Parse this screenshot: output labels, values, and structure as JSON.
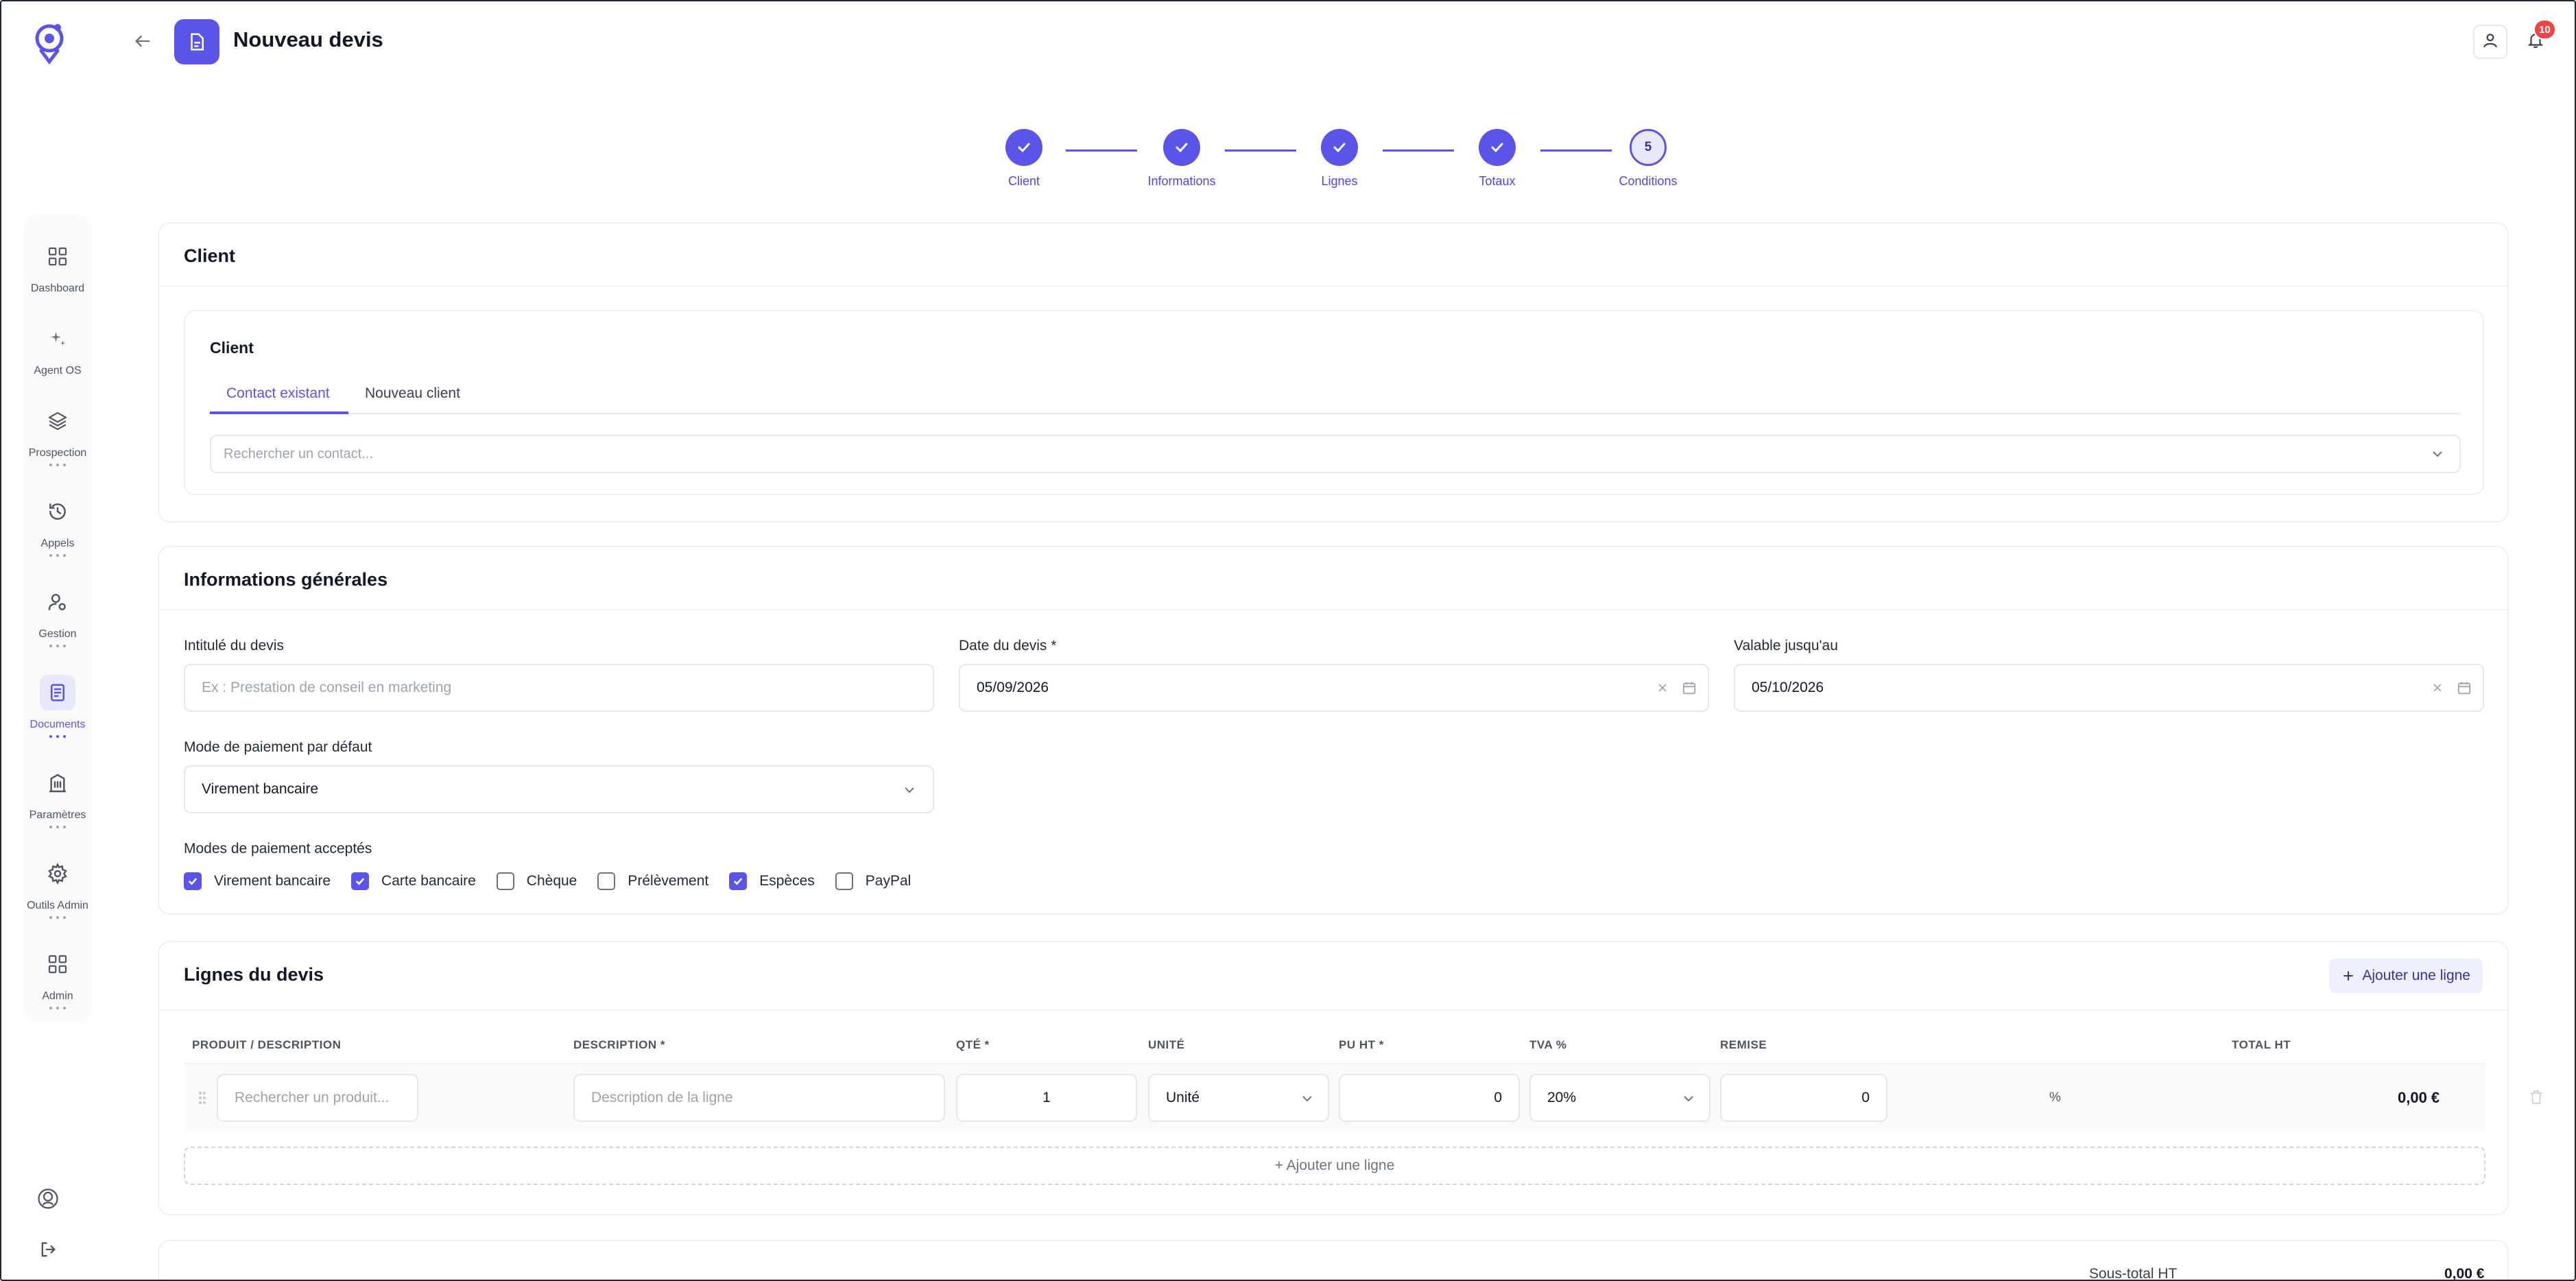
{
  "header": {
    "title": "Nouveau devis",
    "notification_count": "10"
  },
  "sidebar": {
    "items": [
      {
        "label": "Dashboard",
        "icon": "grid-icon",
        "active": false
      },
      {
        "label": "Agent OS",
        "icon": "sparkles-icon",
        "active": false
      },
      {
        "label": "Prospection",
        "icon": "layers-icon",
        "active": false
      },
      {
        "label": "Appels",
        "icon": "history-icon",
        "active": false
      },
      {
        "label": "Gestion",
        "icon": "user-settings-icon",
        "active": false
      },
      {
        "label": "Documents",
        "icon": "document-icon",
        "active": true
      },
      {
        "label": "Paramètres",
        "icon": "building-icon",
        "active": false
      },
      {
        "label": "Outils Admin",
        "icon": "gear-icon",
        "active": false
      },
      {
        "label": "Admin",
        "icon": "grid-icon",
        "active": false
      }
    ]
  },
  "stepper": {
    "steps": [
      {
        "label": "Client",
        "done": true
      },
      {
        "label": "Informations",
        "done": true
      },
      {
        "label": "Lignes",
        "done": true
      },
      {
        "label": "Totaux",
        "done": true
      },
      {
        "label": "Conditions",
        "number": "5",
        "done": false
      }
    ]
  },
  "client_section": {
    "title": "Client",
    "inner_title": "Client",
    "tabs": [
      "Contact existant",
      "Nouveau client"
    ],
    "search_placeholder": "Rechercher un contact..."
  },
  "info_section": {
    "title": "Informations générales",
    "quote_title_label": "Intitulé du devis",
    "quote_title_placeholder": "Ex : Prestation de conseil en marketing",
    "date_label": "Date du devis *",
    "date_value": "05/09/2026",
    "valid_label": "Valable jusqu'au",
    "valid_value": "05/10/2026",
    "payment_mode_label": "Mode de paiement par défaut",
    "payment_mode_value": "Virement bancaire",
    "accepted_label": "Modes de paiement acceptés",
    "accepted_modes": [
      {
        "label": "Virement bancaire",
        "checked": true
      },
      {
        "label": "Carte bancaire",
        "checked": true
      },
      {
        "label": "Chèque",
        "checked": false
      },
      {
        "label": "Prélèvement",
        "checked": false
      },
      {
        "label": "Espèces",
        "checked": true
      },
      {
        "label": "PayPal",
        "checked": false
      }
    ]
  },
  "lines_section": {
    "title": "Lignes du devis",
    "add_button": "Ajouter une ligne",
    "columns": [
      "PRODUIT / DESCRIPTION",
      "DESCRIPTION *",
      "QTÉ *",
      "UNITÉ",
      "PU HT *",
      "TVA %",
      "REMISE",
      "TOTAL HT"
    ],
    "row": {
      "product_placeholder": "Rechercher un produit...",
      "description_placeholder": "Description de la ligne",
      "qty": "1",
      "unit": "Unité",
      "pu_ht": "0",
      "tva": "20%",
      "discount": "0",
      "discount_unit": "%",
      "total": "0,00 €"
    },
    "add_dashed": "+ Ajouter une ligne"
  },
  "totals": {
    "subtotal_label": "Sous-total HT",
    "subtotal_value": "0,00 €"
  },
  "colors": {
    "accent": "#5b54e8",
    "badge": "#ef4444"
  }
}
